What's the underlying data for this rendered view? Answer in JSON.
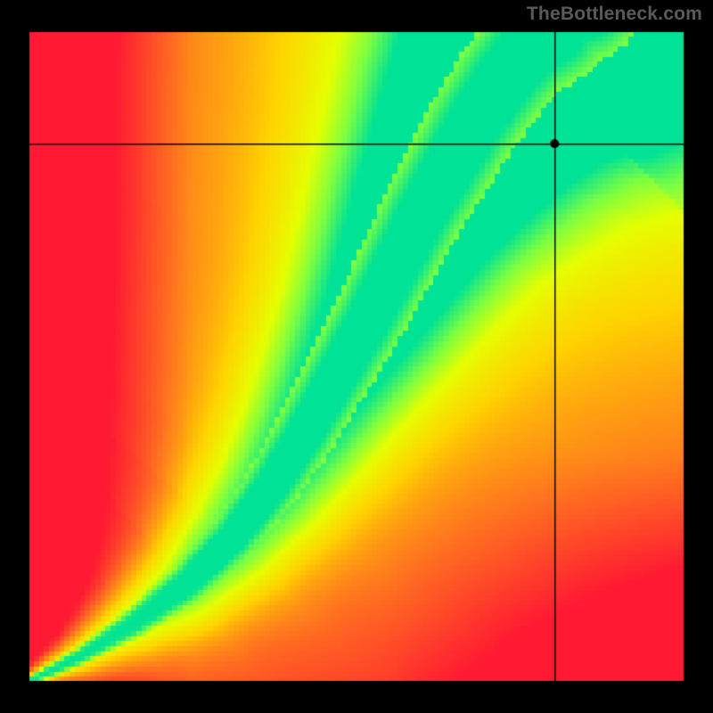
{
  "attribution": "TheBottleneck.com",
  "colors": {
    "stops": [
      {
        "t": 0.0,
        "hex": "#ff1a33"
      },
      {
        "t": 0.25,
        "hex": "#ff7a1e"
      },
      {
        "t": 0.5,
        "hex": "#ffd400"
      },
      {
        "t": 0.7,
        "hex": "#e6ff00"
      },
      {
        "t": 0.85,
        "hex": "#7fff40"
      },
      {
        "t": 1.0,
        "hex": "#00e296"
      }
    ],
    "crosshair": "#000000",
    "marker": "#000000",
    "pixel_border": "#000000"
  },
  "chart_data": {
    "type": "heatmap",
    "title": "",
    "xlabel": "",
    "ylabel": "",
    "x_range": [
      0,
      1
    ],
    "y_range": [
      0,
      1
    ],
    "ridge": [
      {
        "x": 0.0,
        "y": 0.0
      },
      {
        "x": 0.08,
        "y": 0.04
      },
      {
        "x": 0.16,
        "y": 0.09
      },
      {
        "x": 0.24,
        "y": 0.15
      },
      {
        "x": 0.31,
        "y": 0.22
      },
      {
        "x": 0.37,
        "y": 0.3
      },
      {
        "x": 0.42,
        "y": 0.38
      },
      {
        "x": 0.47,
        "y": 0.47
      },
      {
        "x": 0.52,
        "y": 0.56
      },
      {
        "x": 0.56,
        "y": 0.64
      },
      {
        "x": 0.6,
        "y": 0.72
      },
      {
        "x": 0.64,
        "y": 0.79
      },
      {
        "x": 0.68,
        "y": 0.86
      },
      {
        "x": 0.72,
        "y": 0.92
      },
      {
        "x": 0.76,
        "y": 0.97
      },
      {
        "x": 0.8,
        "y": 1.0
      }
    ],
    "ridge_width": {
      "base": 0.008,
      "growth": 0.085
    },
    "background_gradient": {
      "corner_ll": 0.0,
      "corner_lr": 0.0,
      "corner_ul": 0.0,
      "corner_ur": 0.56,
      "boost_along_ridge": 0.45
    },
    "crosshair": {
      "x": 0.802,
      "y": 0.827
    },
    "grid_cells": 128
  }
}
